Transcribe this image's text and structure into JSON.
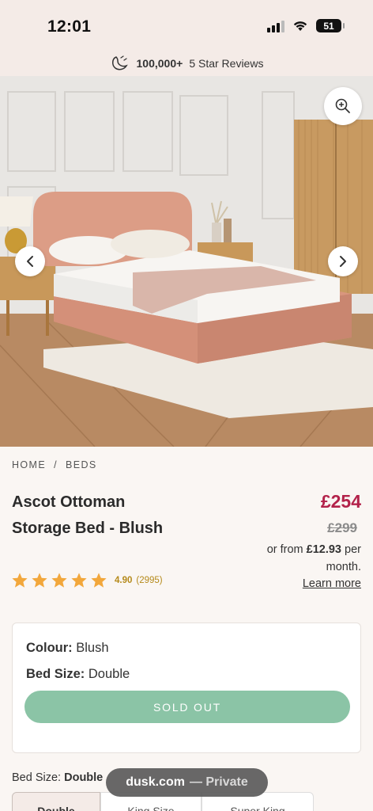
{
  "status_bar": {
    "time": "12:01",
    "battery": "51"
  },
  "banner": {
    "count": "100,000+",
    "text": "5 Star Reviews"
  },
  "breadcrumb": {
    "home": "HOME",
    "sep": "/",
    "current": "BEDS"
  },
  "product": {
    "title_line1": "Ascot Ottoman",
    "title_line2": "Storage Bed - Blush",
    "price_now": "£254",
    "price_was": "£299",
    "finance_prefix": "or from ",
    "finance_amount": "£12.93",
    "finance_suffix": " per month.",
    "learn_more": "Learn more"
  },
  "rating": {
    "value": 4.9,
    "score": "4.90",
    "count": "(2995)",
    "stars": 5
  },
  "options_card": {
    "colour_label": "Colour:",
    "colour_value": "Blush",
    "size_label": "Bed Size:",
    "size_value": "Double",
    "sold_out": "SOLD OUT"
  },
  "size_selector": {
    "label": "Bed Size:",
    "value": "Double",
    "options": [
      "Double",
      "King Size",
      "Super King"
    ]
  },
  "browser_pill": {
    "domain": "dusk.com",
    "suffix": "— Private"
  },
  "colors": {
    "accent_price": "#b3224a",
    "sold_out": "#8bc4a6",
    "stars": "#f2a73b",
    "banner_bg": "#f4ebe7"
  }
}
